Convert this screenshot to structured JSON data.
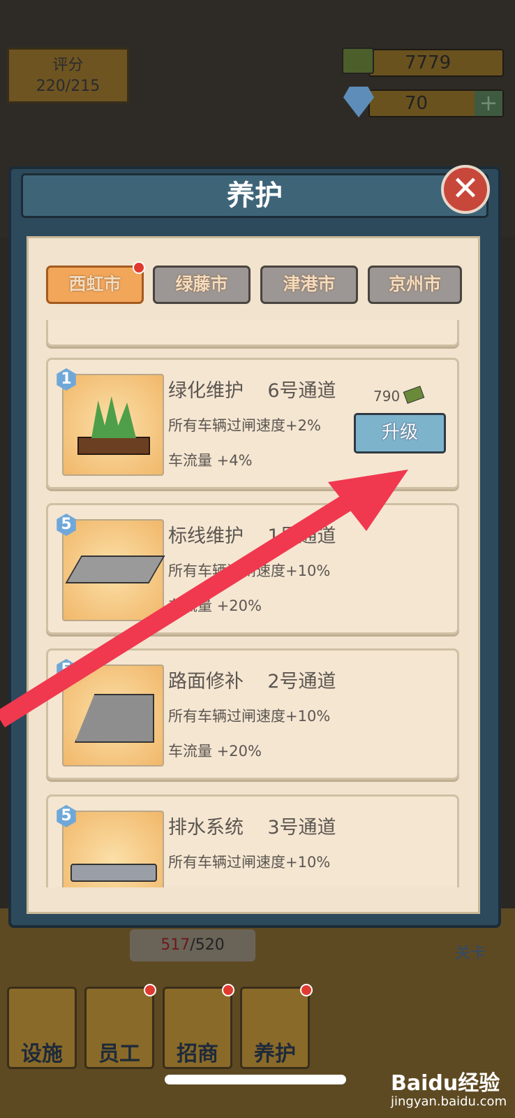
{
  "hud": {
    "score_label": "评分",
    "score_value": "220/215",
    "money": "7779",
    "gems": "70",
    "plus": "+"
  },
  "dialog": {
    "title": "养护",
    "close": "✕",
    "tabs": [
      {
        "label": "西虹市",
        "active": true,
        "dot": true
      },
      {
        "label": "绿藤市"
      },
      {
        "label": "津港市"
      },
      {
        "label": "京州市"
      }
    ],
    "items": [
      {
        "level": "1",
        "name": "绿化维护",
        "lane": "6号通道",
        "effect1": "所有车辆过闸速度+2%",
        "effect2": "车流量 +4%",
        "cost": "790",
        "button": "升级",
        "icon": "grass-icon"
      },
      {
        "level": "5",
        "name": "标线维护",
        "lane": "1号通道",
        "effect1": "所有车辆过闸速度+10%",
        "effect2": "车流量 +20%",
        "icon": "road-marking-icon"
      },
      {
        "level": "5",
        "name": "路面修补",
        "lane": "2号通道",
        "effect1": "所有车辆过闸速度+10%",
        "effect2": "车流量 +20%",
        "icon": "cracked-road-icon"
      },
      {
        "level": "5",
        "name": "排水系统",
        "lane": "3号通道",
        "effect1": "所有车辆过闸速度+10%",
        "icon": "pipe-icon"
      }
    ]
  },
  "background": {
    "progress_current": "517",
    "progress_total": "/520",
    "level_label": "关卡"
  },
  "nav": [
    {
      "label": "设施"
    },
    {
      "label": "员工",
      "dot": true
    },
    {
      "label": "招商",
      "dot": true
    },
    {
      "label": "养护",
      "dot": true
    }
  ],
  "watermark": {
    "brand": "Baidu经验",
    "url": "jingyan.baidu.com"
  },
  "colors": {
    "arrow": "#f0384f",
    "active_tab": "#f2a65a",
    "upgrade_button": "#7eb3cc"
  }
}
